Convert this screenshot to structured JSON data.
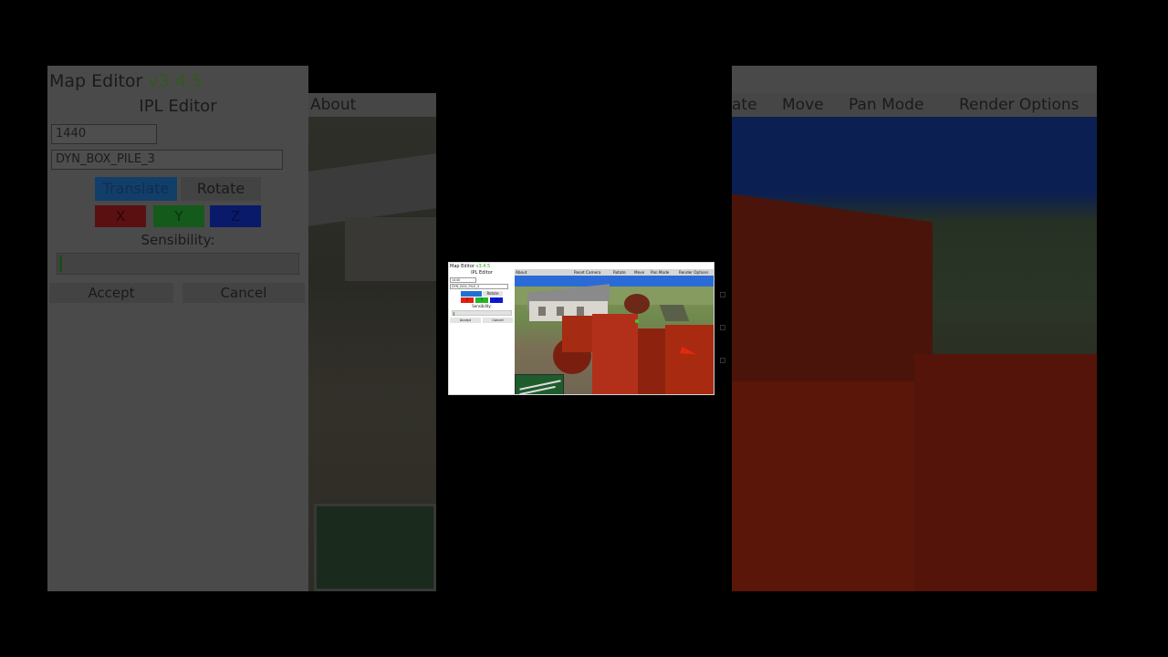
{
  "window": {
    "app_name": "Map Editor",
    "version": "v3.4.5",
    "panel_title": "IPL Editor"
  },
  "editor": {
    "id_value": "1440",
    "model_name": "DYN_BOX_PILE_3",
    "mode_translate": "Translate",
    "mode_rotate": "Rotate",
    "axis_x": "X",
    "axis_y": "Y",
    "axis_z": "Z",
    "sensibility_label": "Sensibility:",
    "accept_label": "Accept",
    "cancel_label": "Cancel"
  },
  "menu": {
    "about": "About",
    "reset_camera": "Reset Camera",
    "rotate": "Rotate",
    "move": "Move",
    "pan_mode": "Pan Mode",
    "render_options": "Render Options"
  },
  "background_menu": {
    "rotate_partial": "ate",
    "move": "Move",
    "pan_mode": "Pan Mode",
    "render_options": "Render Options"
  },
  "colors": {
    "translate_active": "#1f72d6",
    "axis_x": "#e12010",
    "axis_y": "#25b52b",
    "axis_z": "#0818d8",
    "version_green": "#2fa51a"
  }
}
